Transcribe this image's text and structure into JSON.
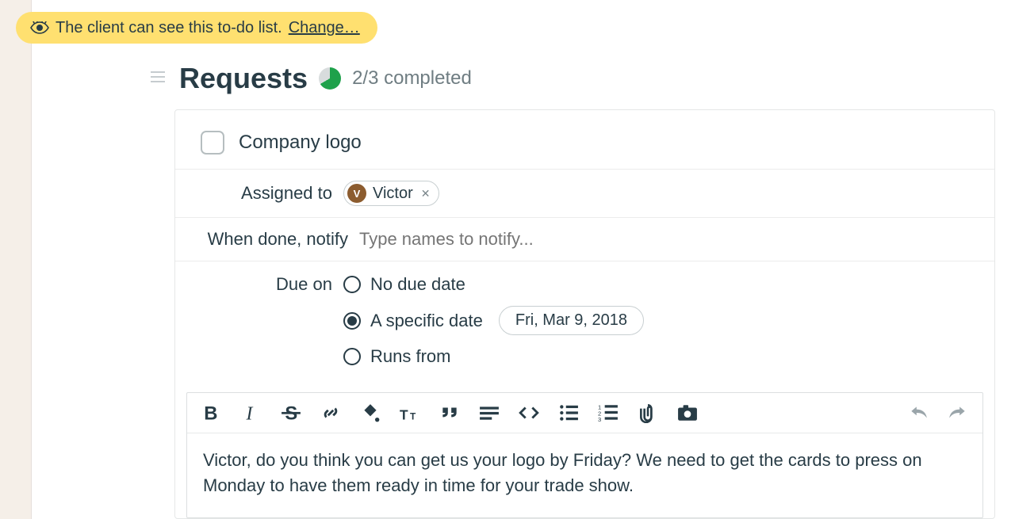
{
  "visibility": {
    "text": "The client can see this to-do list.",
    "change_label": "Change…"
  },
  "list": {
    "title": "Requests",
    "progress_label": "2/3 completed"
  },
  "todo": {
    "name": "Company logo",
    "assigned_label": "Assigned to",
    "assignee": {
      "initial": "V",
      "name": "Victor"
    },
    "notify_label": "When done, notify",
    "notify_placeholder": "Type names to notify...",
    "due_label": "Due on",
    "due_options": {
      "none": "No due date",
      "specific": "A specific date",
      "range": "Runs from"
    },
    "due_date": "Fri, Mar 9, 2018",
    "body": "Victor, do you think you can get us your logo by Friday? We need to get the cards to press on Monday to have them ready in time for your trade show."
  }
}
